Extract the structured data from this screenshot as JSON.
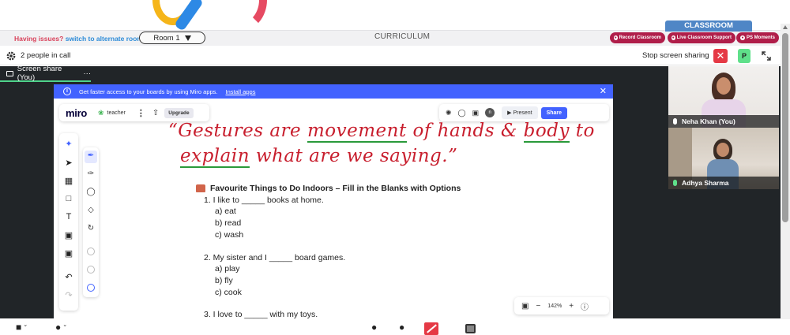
{
  "header": {
    "issues_text": "Having issues?",
    "alt_room_link": "switch to alternate room",
    "room_selector": "Room 1",
    "curriculum_label": "CURRICULUM",
    "classroom_tab": "CLASSROOM",
    "buttons": {
      "record": "Record Classroom",
      "live_support": "Live Classroom Support",
      "moments": "PS Moments"
    }
  },
  "call": {
    "people_count": "2 people in call",
    "stop_share": "Stop screen sharing",
    "participant_initial": "P",
    "screen_share_tab": "Screen share (You)",
    "screen_share_more": "···"
  },
  "miro": {
    "banner_text": "Get faster access to your boards by using Miro apps.",
    "install_link": "Install apps",
    "logo": "miro",
    "board_name": "teacher",
    "upgrade": "Upgrade",
    "present": "Present",
    "share": "Share",
    "avatar_initial": "n",
    "zoom": "142%",
    "handwriting_line1_a": "“Gestures are ",
    "handwriting_line1_b": "movement",
    "handwriting_line1_c": " of hands & ",
    "handwriting_line1_d": "body",
    "handwriting_line1_e": " to",
    "handwriting_line2_a": "explain",
    "handwriting_line2_b": " what are we saying.”"
  },
  "worksheet": {
    "title": "Favourite Things to Do Indoors – Fill in the Blanks with Options",
    "questions": [
      {
        "text": "1. I like to _____ books at home.",
        "options": [
          "a) eat",
          "b) read",
          "c) wash"
        ]
      },
      {
        "text": "2. My sister and I _____ board games.",
        "options": [
          "a) play",
          "b) fly",
          "c) cook"
        ]
      },
      {
        "text": "3. I love to _____ with my toys.",
        "options": []
      }
    ]
  },
  "participants": [
    {
      "name": "Neha Khan (You)"
    },
    {
      "name": "Adhya Sharma"
    }
  ],
  "colors": {
    "accent_blue": "#4262ff",
    "stop_red": "#e53945",
    "handwriting_red": "#c81e2d",
    "underline_green": "#2a9a3a",
    "pill_maroon": "#b01e4a"
  }
}
